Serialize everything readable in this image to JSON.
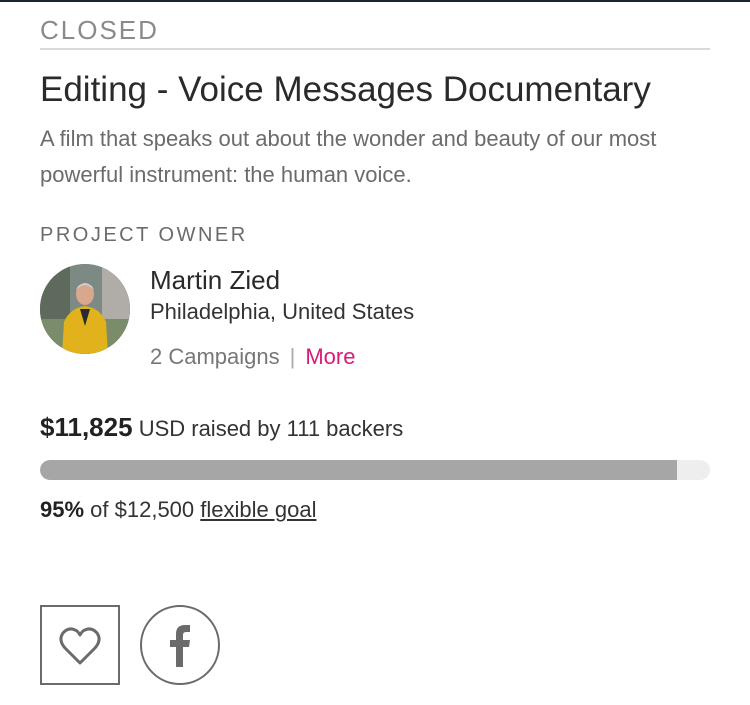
{
  "campaign": {
    "status": "CLOSED",
    "title": "Editing - Voice Messages Documentary",
    "description": "A film that speaks out about the wonder and beauty of our most powerful instrument: the human voice."
  },
  "owner": {
    "section_label": "PROJECT OWNER",
    "name": "Martin Zied",
    "location": "Philadelphia, United States",
    "campaigns": "2 Campaigns",
    "separator": "|",
    "more_label": "More",
    "more_color": "#d81b7a"
  },
  "funding": {
    "amount": "$11,825",
    "raised_text": "USD raised by 111 backers",
    "progress_fraction": 0.95,
    "percent": "95%",
    "goal_text": "of $12,500",
    "goal_link": "flexible goal",
    "bar_color": "#a6a6a6",
    "track_color": "#eeeeee"
  },
  "actions": {
    "follow_icon": "heart-icon",
    "share_icon": "facebook-icon"
  }
}
